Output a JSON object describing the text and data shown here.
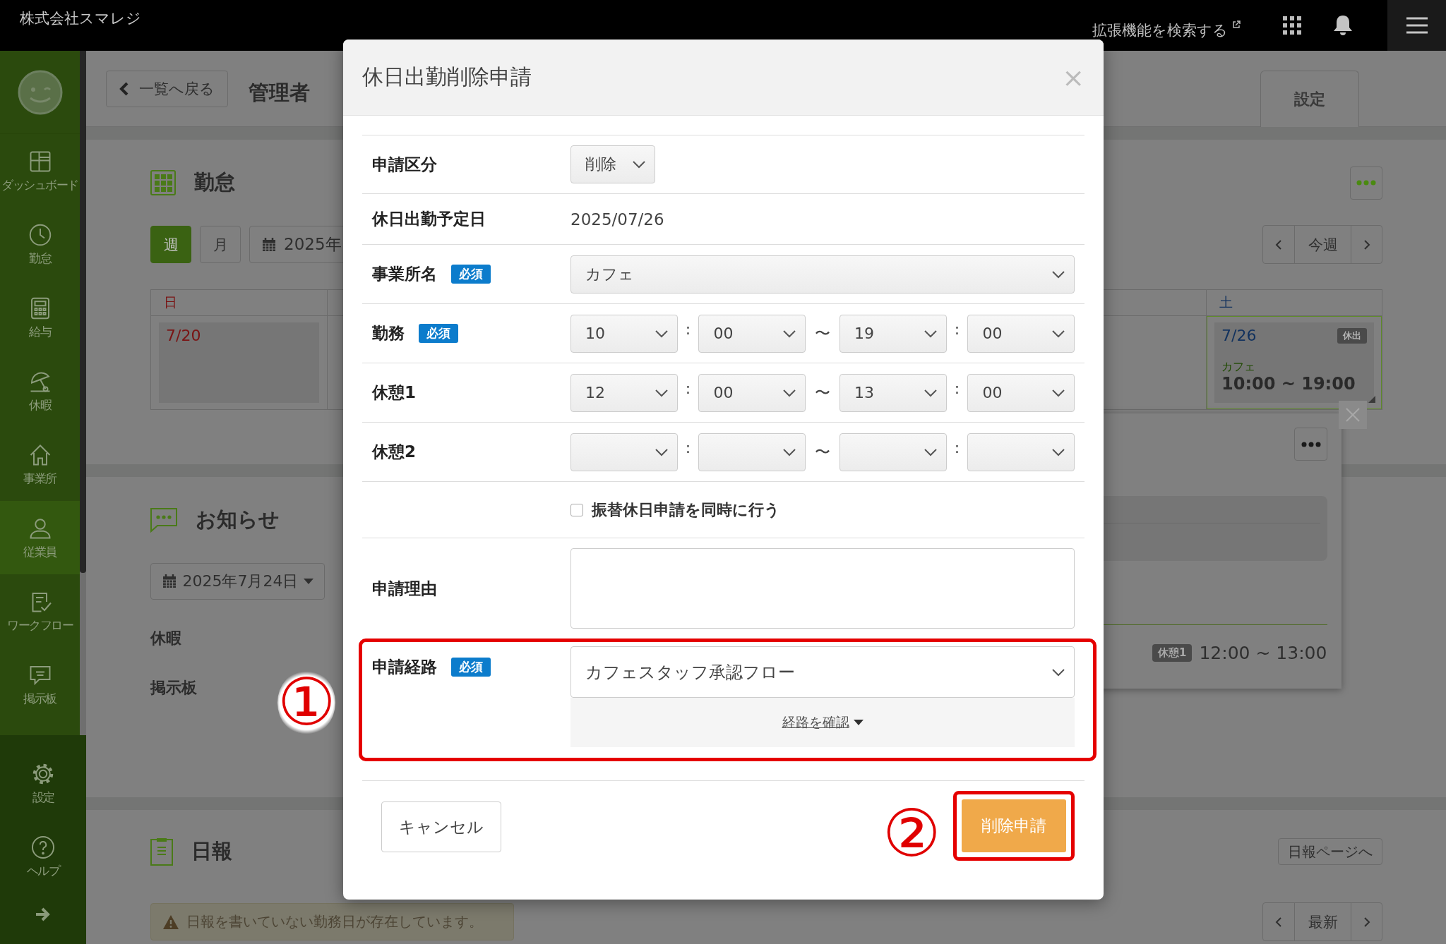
{
  "top_bar": {
    "company": "株式会社スマレジ",
    "extension_search": "拡張機能を検索する"
  },
  "sidebar": {
    "items": [
      {
        "label": "ダッシュボード",
        "kind": "dashboard",
        "selected": false
      },
      {
        "label": "勤怠",
        "kind": "clock",
        "selected": false
      },
      {
        "label": "給与",
        "kind": "calculator",
        "selected": false
      },
      {
        "label": "休暇",
        "kind": "umbrella",
        "selected": false
      },
      {
        "label": "事業所",
        "kind": "home",
        "selected": false
      },
      {
        "label": "従業員",
        "kind": "person",
        "selected": true
      },
      {
        "label": "ワークフロー",
        "kind": "checklist",
        "selected": false
      },
      {
        "label": "掲示板",
        "kind": "chat",
        "selected": false
      }
    ],
    "footer_items": [
      {
        "label": "設定",
        "kind": "gear"
      },
      {
        "label": "ヘルプ",
        "kind": "help"
      }
    ]
  },
  "header": {
    "back_button": "一覧へ戻る",
    "title": "管理者",
    "tab": "設定"
  },
  "attendance": {
    "title": "勤怠",
    "views": [
      {
        "label": "週",
        "selected": true
      },
      {
        "label": "月",
        "selected": false
      }
    ],
    "date_button": "2025年",
    "today_button": "今週",
    "days": [
      {
        "kind": "sunday",
        "weekday": "日",
        "date": "7/20",
        "selected": false
      },
      {
        "kind": "saturday",
        "weekday": "土",
        "date": "7/26",
        "badge": "休出",
        "place": "カフェ",
        "time": "10:00 ~ 19:00",
        "selected": true
      }
    ],
    "popover": {
      "break_badge": "休憩1",
      "break_time": "12:00 ~ 13:00"
    }
  },
  "notices": {
    "title": "お知らせ",
    "date": "2025年7月24日",
    "sections": [
      "休暇",
      "掲示板"
    ]
  },
  "daily_report": {
    "title": "日報",
    "page_button": "日報ページへ",
    "warning": "日報を書いていない勤務日が存在しています。",
    "latest_button": "最新"
  },
  "dialog": {
    "title": "休日出勤削除申請",
    "close": "×",
    "rows": [
      {
        "kind": "select",
        "label": "申請区分",
        "value": "削除"
      },
      {
        "kind": "text",
        "label": "休日出勤予定日",
        "value": "2025/07/26"
      },
      {
        "kind": "select_wide",
        "label": "事業所名",
        "badge": "必須",
        "value": "カフェ"
      },
      {
        "kind": "time_range",
        "label": "勤務",
        "badge": "必須",
        "start_hour": "10",
        "start_colon": ":",
        "start_minute": "00",
        "tilde": "〜",
        "end_hour": "19",
        "end_colon": ":",
        "end_minute": "00"
      },
      {
        "kind": "time_range",
        "label": "休憩1",
        "start_hour": "12",
        "start_colon": ":",
        "start_minute": "00",
        "tilde": "〜",
        "end_hour": "13",
        "end_colon": ":",
        "end_minute": "00"
      },
      {
        "kind": "time_range",
        "label": "休憩2",
        "start_colon": ":",
        "tilde": "〜",
        "end_colon": ":"
      },
      {
        "kind": "checkbox",
        "label": "振替休日申請を同時に行う",
        "checked": false
      },
      {
        "kind": "textarea",
        "label": "申請理由"
      },
      {
        "kind": "route",
        "label": "申請経路",
        "badge": "必須",
        "value": "カフェスタッフ承認フロー",
        "link": "経路を確認",
        "highlighted": true
      }
    ],
    "cancel": "キャンセル",
    "submit": "削除申請",
    "submit_highlighted": true
  },
  "annotations": [
    {
      "label": "①"
    },
    {
      "label": "②"
    }
  ]
}
